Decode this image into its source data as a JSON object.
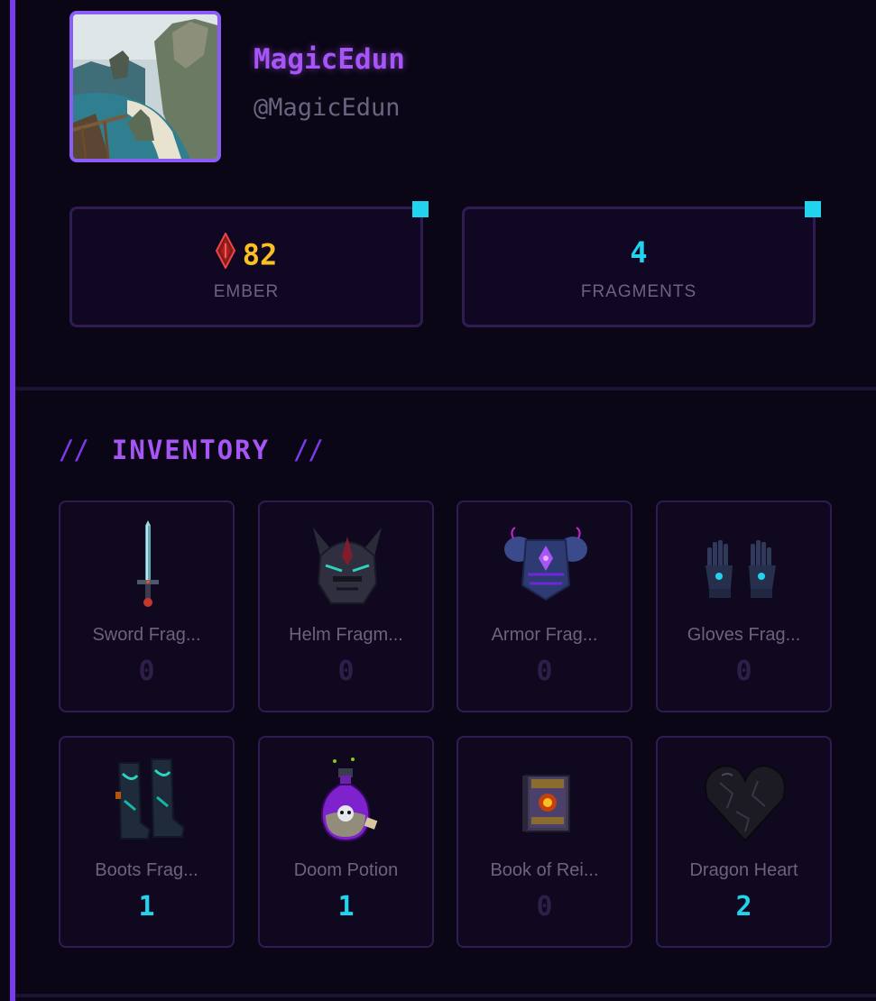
{
  "profile": {
    "display_name": "MagicEdun",
    "handle": "@MagicEdun"
  },
  "stats": {
    "ember": {
      "value": "82",
      "label": "EMBER",
      "icon": "ember-gem-icon",
      "color": "#fbbf24"
    },
    "fragments": {
      "value": "4",
      "label": "FRAGMENTS",
      "color": "#22d3ee"
    }
  },
  "inventory": {
    "slashes_left": "//",
    "title": "INVENTORY",
    "slashes_right": "//",
    "items": [
      {
        "name": "Sword Frag...",
        "count": "0",
        "icon": "sword-icon"
      },
      {
        "name": "Helm Fragm...",
        "count": "0",
        "icon": "helm-icon"
      },
      {
        "name": "Armor Frag...",
        "count": "0",
        "icon": "armor-icon"
      },
      {
        "name": "Gloves Frag...",
        "count": "0",
        "icon": "gloves-icon"
      },
      {
        "name": "Boots Frag...",
        "count": "1",
        "icon": "boots-icon"
      },
      {
        "name": "Doom Potion",
        "count": "1",
        "icon": "potion-icon"
      },
      {
        "name": "Book of Rei...",
        "count": "0",
        "icon": "book-icon"
      },
      {
        "name": "Dragon Heart",
        "count": "2",
        "icon": "heart-icon"
      }
    ]
  },
  "colors": {
    "accent": "#a855f7",
    "rail": "#7c3aed",
    "highlight": "#22d3ee",
    "background": "#0b0616"
  }
}
